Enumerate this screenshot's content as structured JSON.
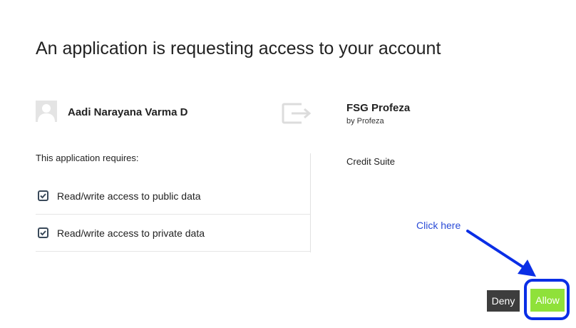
{
  "header": {
    "title": "An application is requesting access to your account"
  },
  "user": {
    "name": "Aadi Narayana Varma D",
    "avatar_icon": "user-avatar-icon"
  },
  "transfer_icon": "sign-in-arrow-icon",
  "application": {
    "name": "FSG Profeza",
    "by": "by Profeza",
    "suite": "Credit Suite"
  },
  "permissions": {
    "heading": "This application requires:",
    "items": [
      {
        "label": "Read/write access to public data",
        "checked": true
      },
      {
        "label": "Read/write access to private data",
        "checked": true
      }
    ]
  },
  "annotation": {
    "text": "Click here",
    "color": "#2a4bd7",
    "highlight_color": "#0a2ee6"
  },
  "actions": {
    "deny_label": "Deny",
    "allow_label": "Allow",
    "deny_color": "#3d3d3d",
    "allow_color": "#8fe13a"
  }
}
